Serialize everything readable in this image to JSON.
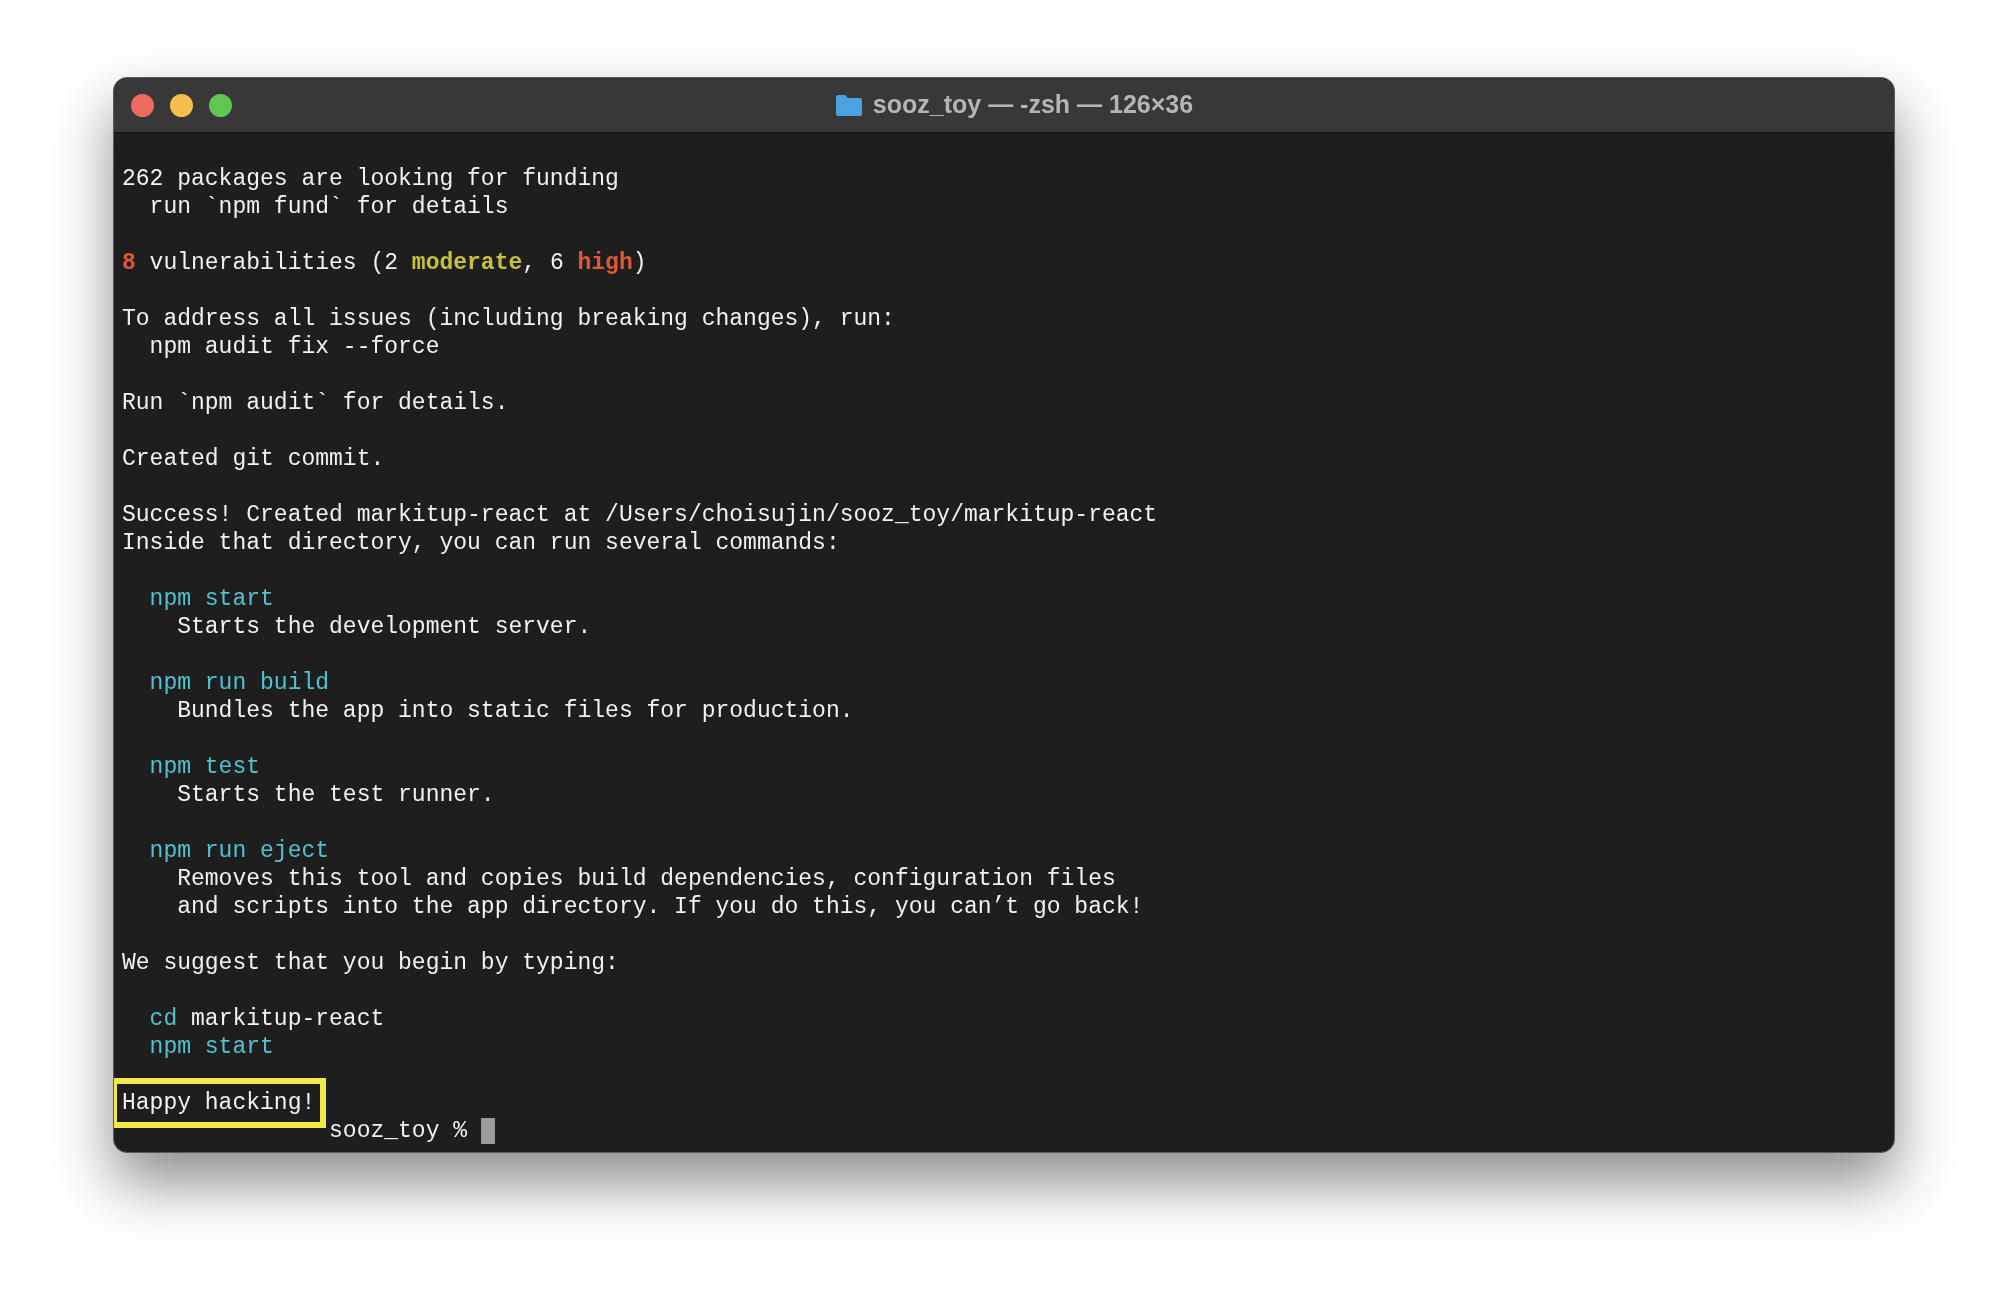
{
  "window": {
    "title": "sooz_toy — -zsh — 126×36"
  },
  "blocks": [
    {
      "lines": [
        {
          "segments": [
            {
              "text": "262 packages are looking for funding",
              "kind": "plain"
            }
          ]
        },
        {
          "segments": [
            {
              "text": "  run `npm fund` for details",
              "kind": "plain"
            }
          ]
        }
      ]
    },
    {
      "lines": [
        {
          "segments": [
            {
              "text": "8",
              "kind": "high"
            },
            {
              "text": " vulnerabilities (2 ",
              "kind": "plain"
            },
            {
              "text": "moderate",
              "kind": "moderate"
            },
            {
              "text": ", 6 ",
              "kind": "plain"
            },
            {
              "text": "high",
              "kind": "high"
            },
            {
              "text": ")",
              "kind": "plain"
            }
          ]
        }
      ]
    },
    {
      "lines": [
        {
          "segments": [
            {
              "text": "To address all issues (including breaking changes), run:",
              "kind": "plain"
            }
          ]
        },
        {
          "segments": [
            {
              "text": "  npm audit fix --force",
              "kind": "plain"
            }
          ]
        }
      ]
    },
    {
      "lines": [
        {
          "segments": [
            {
              "text": "Run `npm audit` for details.",
              "kind": "plain"
            }
          ]
        }
      ]
    },
    {
      "lines": [
        {
          "segments": [
            {
              "text": "Created git commit.",
              "kind": "plain"
            }
          ]
        }
      ]
    },
    {
      "lines": [
        {
          "segments": [
            {
              "text": "Success! Created markitup-react at /Users/choisujin/sooz_toy/markitup-react",
              "kind": "plain"
            }
          ]
        },
        {
          "segments": [
            {
              "text": "Inside that directory, you can run several commands:",
              "kind": "plain"
            }
          ]
        }
      ]
    },
    {
      "lines": [
        {
          "segments": [
            {
              "text": "  npm start",
              "kind": "command"
            }
          ]
        },
        {
          "segments": [
            {
              "text": "    Starts the development server.",
              "kind": "plain"
            }
          ]
        }
      ]
    },
    {
      "lines": [
        {
          "segments": [
            {
              "text": "  npm run build",
              "kind": "command"
            }
          ]
        },
        {
          "segments": [
            {
              "text": "    Bundles the app into static files for production.",
              "kind": "plain"
            }
          ]
        }
      ]
    },
    {
      "lines": [
        {
          "segments": [
            {
              "text": "  npm test",
              "kind": "command"
            }
          ]
        },
        {
          "segments": [
            {
              "text": "    Starts the test runner.",
              "kind": "plain"
            }
          ]
        }
      ]
    },
    {
      "lines": [
        {
          "segments": [
            {
              "text": "  npm run eject",
              "kind": "command"
            }
          ]
        },
        {
          "segments": [
            {
              "text": "    Removes this tool and copies build dependencies, configuration files",
              "kind": "plain"
            }
          ]
        },
        {
          "segments": [
            {
              "text": "    and scripts into the app directory. If you do this, you can’t go back!",
              "kind": "plain"
            }
          ]
        }
      ]
    },
    {
      "lines": [
        {
          "segments": [
            {
              "text": "We suggest that you begin by typing:",
              "kind": "plain"
            }
          ]
        }
      ]
    },
    {
      "lines": [
        {
          "segments": [
            {
              "text": "  cd",
              "kind": "command"
            },
            {
              "text": " markitup-react",
              "kind": "plain"
            }
          ]
        },
        {
          "segments": [
            {
              "text": "  npm start",
              "kind": "command"
            }
          ]
        }
      ]
    },
    {
      "lines": [
        {
          "highlighted": true,
          "segments": [
            {
              "text": "Happy hacking!",
              "kind": "plain"
            }
          ]
        },
        {
          "prompt": true,
          "segments": [
            {
              "text": "sooz_toy % ",
              "kind": "plain"
            }
          ]
        }
      ]
    }
  ]
}
